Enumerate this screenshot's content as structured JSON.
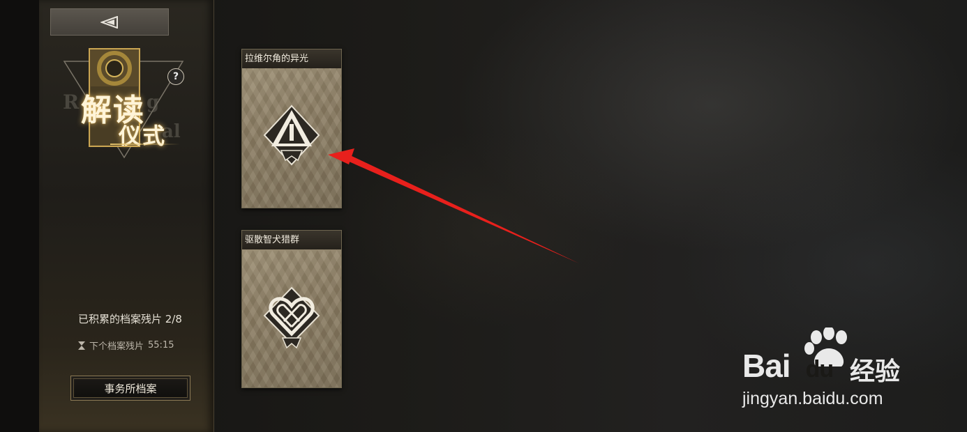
{
  "sidebar": {
    "back_button": {
      "icon": "back-triangle-icon"
    },
    "logo": {
      "title_line1": "解读",
      "title_line2": "仪式",
      "bg_letters_a": "R",
      "bg_letters_b": "g",
      "bg_letters_c": "al"
    },
    "help_label": "?",
    "fragments_accumulated": "已积累的档案残片 2/8",
    "next_fragment_label": "下个档案残片",
    "next_fragment_time": "55:15",
    "archive_button_label": "事务所档案"
  },
  "cards": [
    {
      "title": "拉维尔角的异光",
      "icon": "triangle-emblem-icon"
    },
    {
      "title": "驱散智犬猎群",
      "icon": "heart-knot-emblem-icon"
    }
  ],
  "annotation": {
    "color": "#e8201c"
  },
  "watermark": {
    "brand": "Bai",
    "brand2": "du",
    "cn": "经验",
    "url": "jingyan.baidu.com"
  }
}
